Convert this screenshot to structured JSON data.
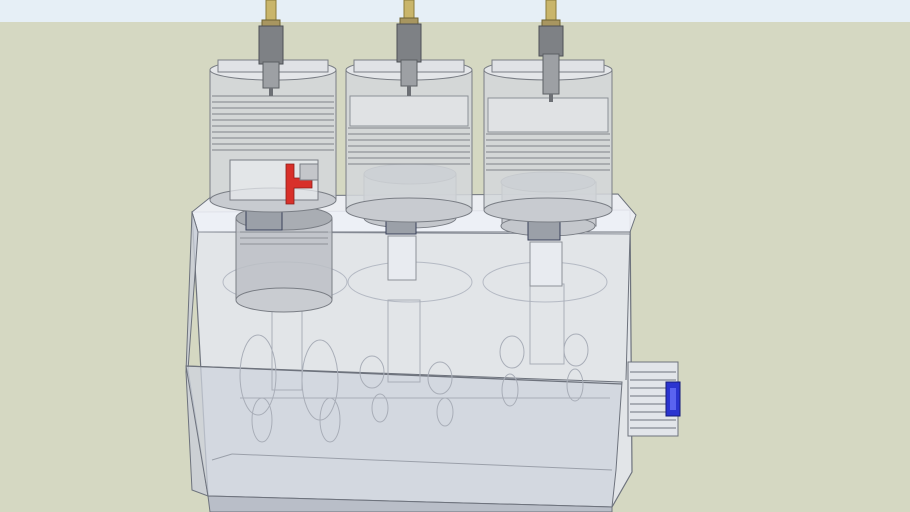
{
  "scene": {
    "view": "3D engine model",
    "cylinder_count": 3,
    "colors": {
      "sky": "#e6eff6",
      "ground": "#d5d8c2",
      "block_fill": "#dfe4ee",
      "block_edge": "#7a7f8a",
      "cylinder_fill": "#d6d9dd",
      "spark_plug_body": "#7e8185",
      "spark_plug_tip": "#c9b56a",
      "piston": "#b8bbbf",
      "arrow_marker": "#d8302a",
      "gear_accent": "#2b34d0"
    },
    "icons": [
      "spark-plug-icon",
      "piston-icon",
      "crankshaft-icon",
      "gear-icon",
      "direction-arrow-icon"
    ]
  }
}
